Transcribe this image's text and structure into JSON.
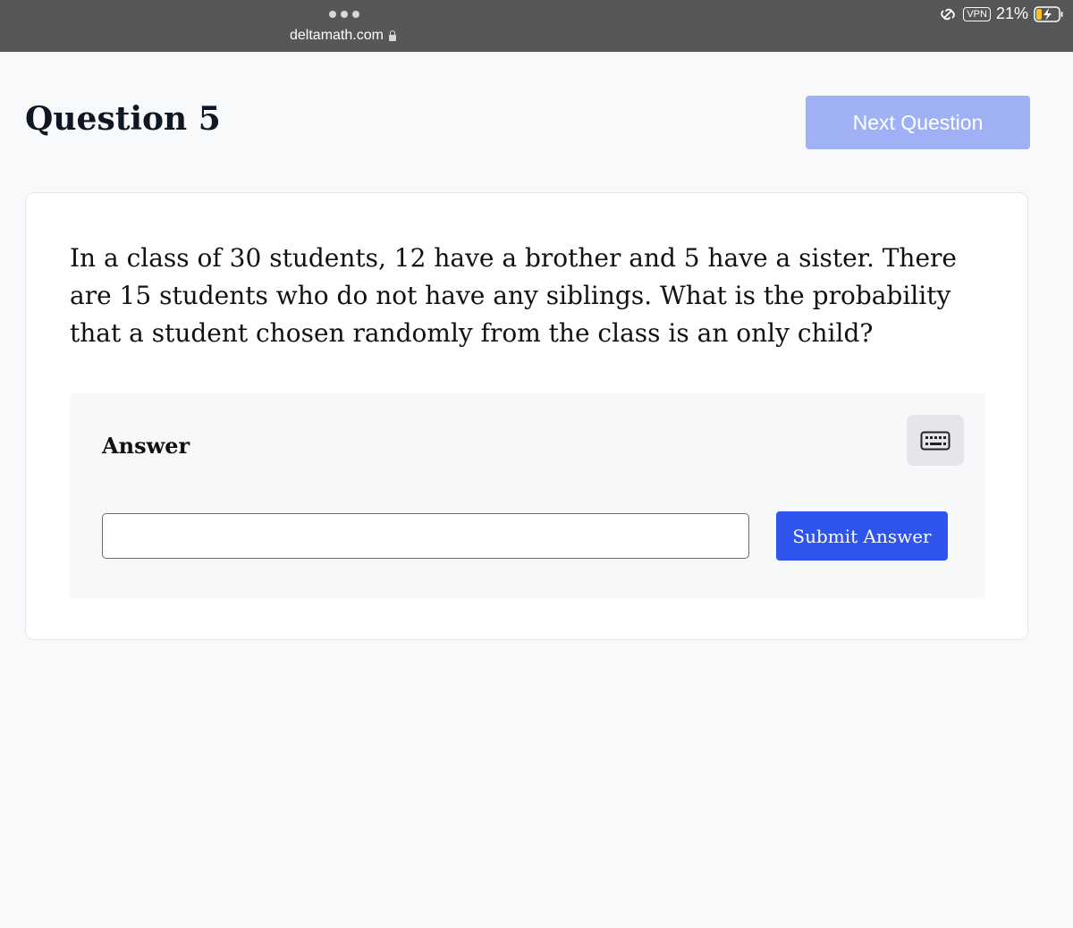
{
  "browser": {
    "url": "deltamath.com",
    "vpn_label": "VPN",
    "battery_percent": "21%"
  },
  "header": {
    "title": "Question 5",
    "next_label": "Next Question"
  },
  "question": {
    "text": "In a class of 30 students, 12 have a brother and 5 have a sister. There are 15 students who do not have any siblings. What is the probability that a student chosen randomly from the class is an only child?"
  },
  "answer": {
    "label": "Answer",
    "input_value": "",
    "submit_label": "Submit Answer"
  },
  "colors": {
    "accent": "#2f54eb",
    "next_disabled": "#9fb0f4",
    "topbar": "#555759"
  },
  "icons": {
    "lock": "lock-icon",
    "link": "link-icon",
    "battery": "battery-charging-icon",
    "keyboard": "keyboard-icon"
  }
}
